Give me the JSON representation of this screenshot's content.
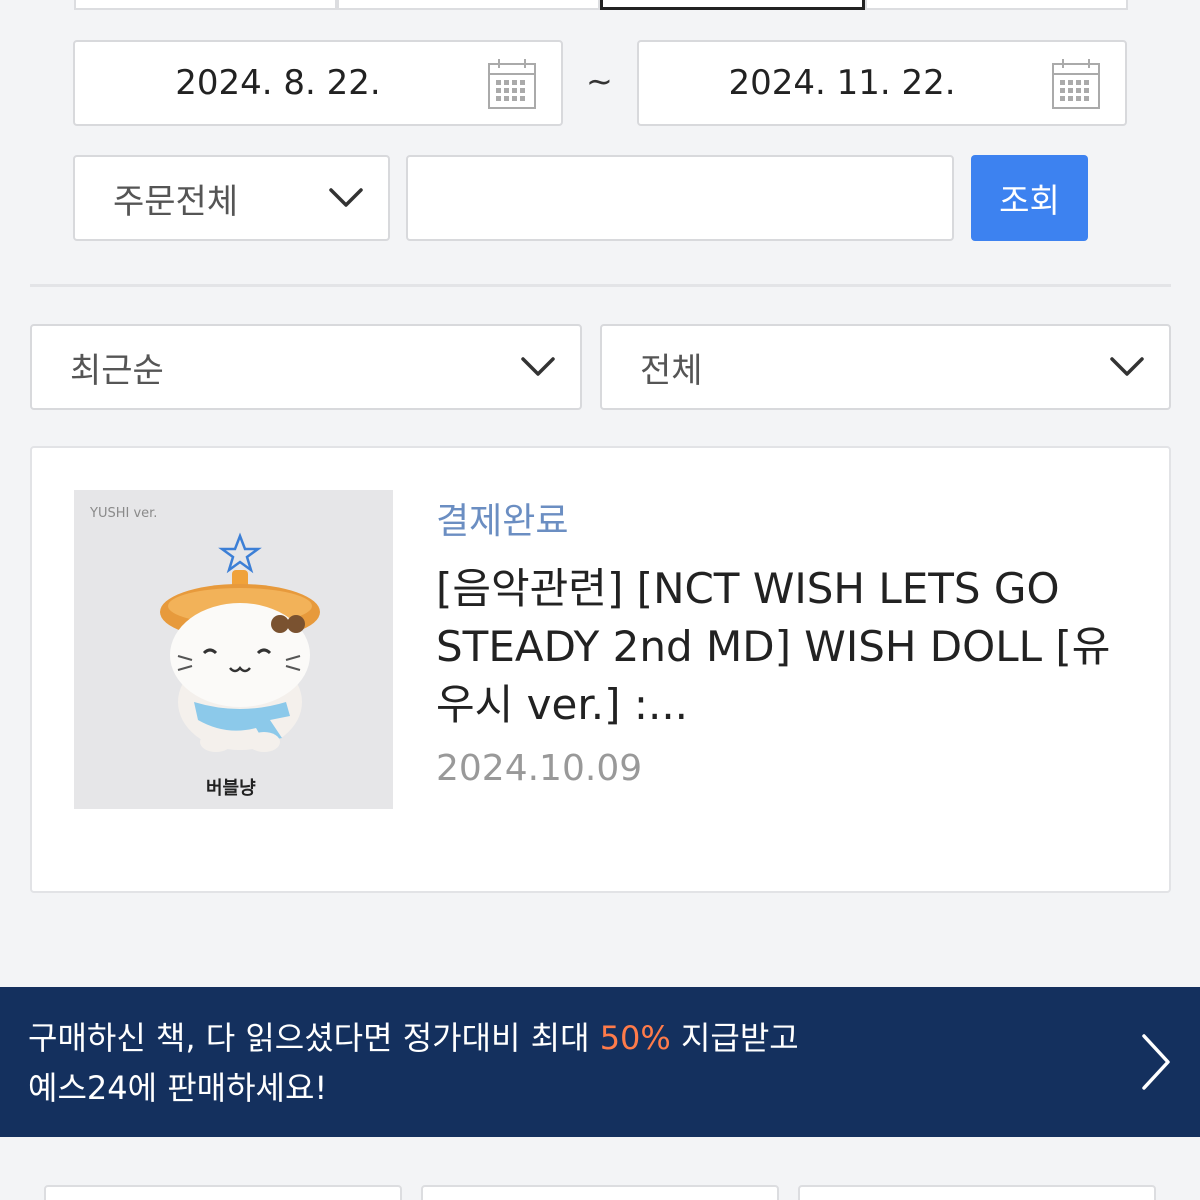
{
  "date_range": {
    "start": "2024. 8. 22.",
    "separator": "~",
    "end": "2024. 11. 22."
  },
  "order_filter": {
    "selected": "주문전체"
  },
  "search": {
    "value": "",
    "placeholder": ""
  },
  "query_button": {
    "label": "조회"
  },
  "sort_select": {
    "selected": "최근순"
  },
  "status_select": {
    "selected": "전체"
  },
  "orders": [
    {
      "status": "결제완료",
      "title": "[음악관련] [NCT WISH LETS GO STEADY 2nd MD] WISH DOLL [유우시 ver.] :...",
      "date": "2024.10.09",
      "thumbnail": {
        "version_label": "YUSHI ver.",
        "brand_label": "버블냥"
      }
    }
  ],
  "promo": {
    "line1_before": "구매하신 책, 다 읽으셨다면 정가대비 최대 ",
    "highlight": "50%",
    "line1_after": " 지급받고",
    "line2": "예스24에 판매하세요!"
  },
  "colors": {
    "accent_button": "#3d82f0",
    "status_text": "#6b8ec2",
    "promo_background": "#14305e",
    "promo_highlight": "#ff7b4a"
  }
}
